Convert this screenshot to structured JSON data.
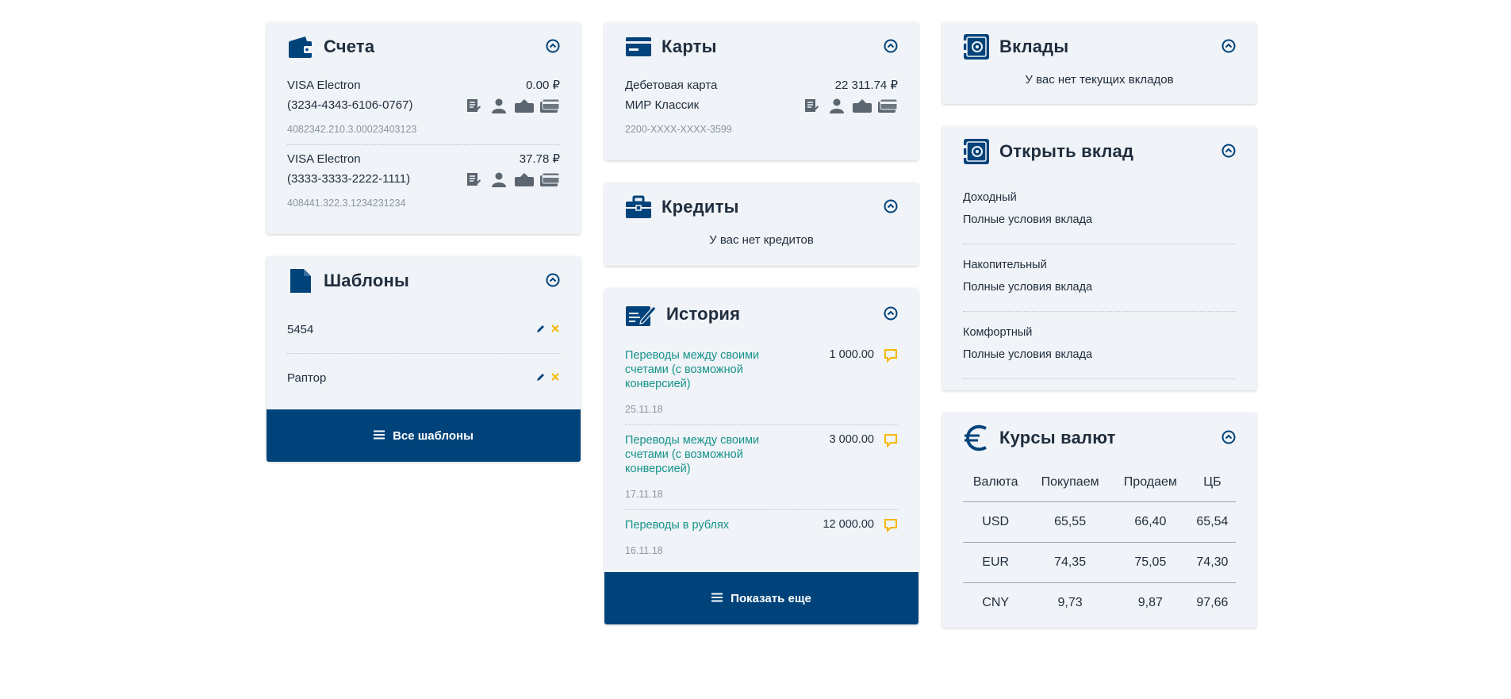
{
  "accounts": {
    "title": "Счета",
    "items": [
      {
        "name": "VISA Electron",
        "amount": "0.00 ₽",
        "card": "(3234-4343-6106-0767)",
        "number": "4082342.210.3.00023403123"
      },
      {
        "name": "VISA Electron",
        "amount": "37.78 ₽",
        "card": "(3333-3333-2222-1111)",
        "number": "408441.322.3.1234231234"
      }
    ]
  },
  "templates": {
    "title": "Шаблоны",
    "items": [
      {
        "label": "5454"
      },
      {
        "label": "Раптор"
      }
    ],
    "button": "Все шаблоны"
  },
  "cards": {
    "title": "Карты",
    "items": [
      {
        "name": "Дебетовая карта",
        "amount": "22 311.74 ₽",
        "sub": "МИР Классик",
        "number": "2200-XXXX-XXXX-3599"
      }
    ]
  },
  "credits": {
    "title": "Кредиты",
    "empty": "У вас нет кредитов"
  },
  "history": {
    "title": "История",
    "items": [
      {
        "title": "Переводы между своими счетами (с возможной конверсией)",
        "amount": "1 000.00",
        "date": "25.11.18"
      },
      {
        "title": "Переводы между своими счетами (с возможной конверсией)",
        "amount": "3 000.00",
        "date": "17.11.18"
      },
      {
        "title": "Переводы в рублях",
        "amount": "12 000.00",
        "date": "16.11.18"
      }
    ],
    "button": "Показать еще"
  },
  "deposits": {
    "title": "Вклады",
    "empty": "У вас нет текущих вкладов"
  },
  "open_deposit": {
    "title": "Открыть вклад",
    "items": [
      {
        "name": "Доходный",
        "link": "Полные условия вклада"
      },
      {
        "name": "Накопительный",
        "link": "Полные условия вклада"
      },
      {
        "name": "Комфортный",
        "link": "Полные условия вклада"
      }
    ]
  },
  "rates": {
    "title": "Курсы валют",
    "headers": [
      "Валюта",
      "Покупаем",
      "Продаем",
      "ЦБ"
    ],
    "rows": [
      [
        "USD",
        "65,55",
        "66,40",
        "65,54"
      ],
      [
        "EUR",
        "74,35",
        "75,05",
        "74,30"
      ],
      [
        "CNY",
        "9,73",
        "9,87",
        "97,66"
      ]
    ]
  },
  "colors": {
    "primary": "#00437a",
    "link": "#16938a",
    "accent": "#f5b800",
    "card_bg": "#f0f3f7"
  }
}
